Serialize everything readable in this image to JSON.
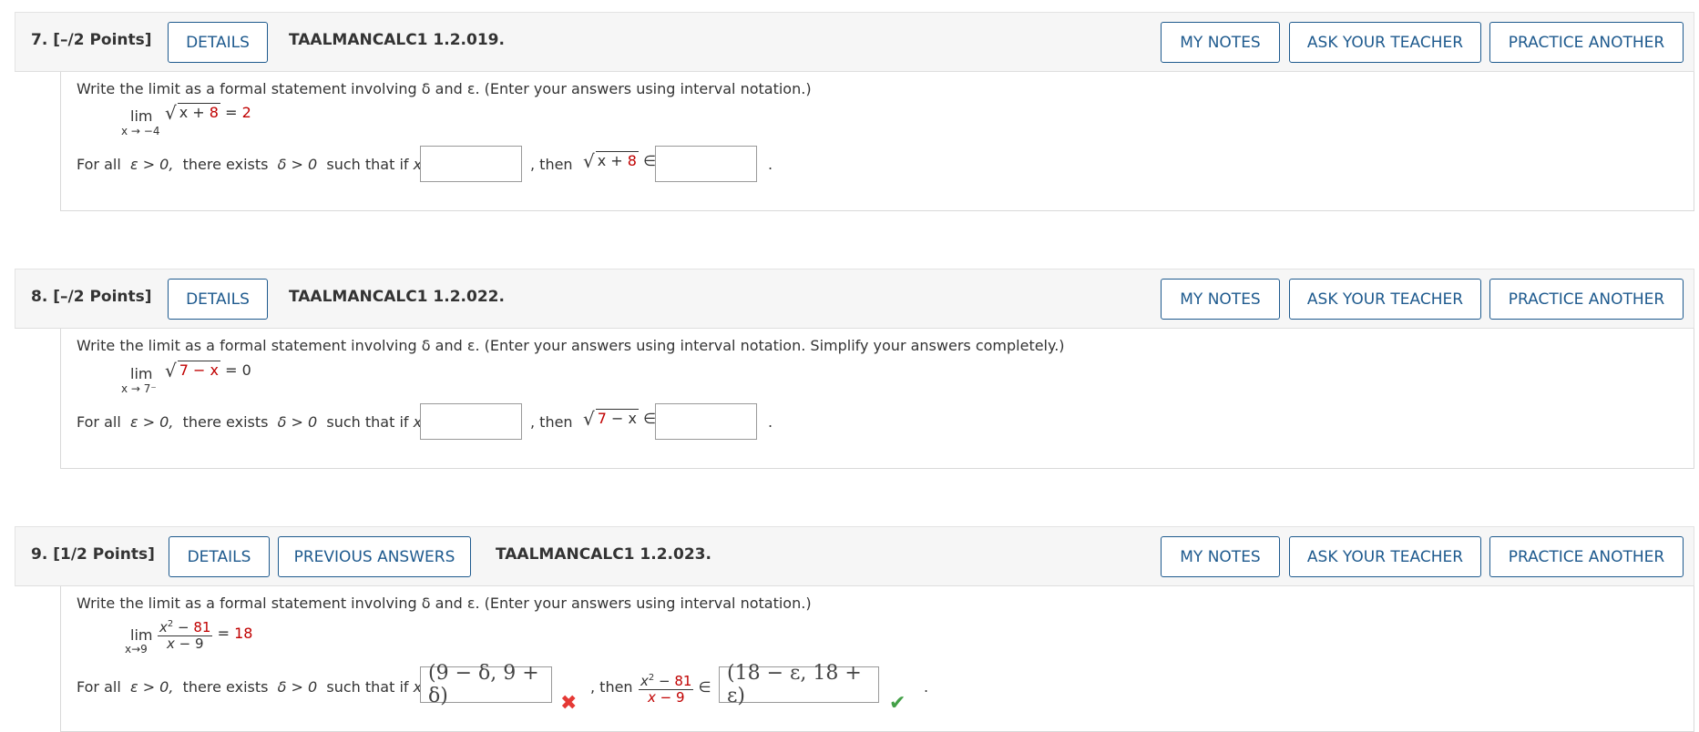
{
  "questions": [
    {
      "number": "7.",
      "points": "[–/2 Points]",
      "code": "TAALMANCALC1 1.2.019.",
      "prompt": "Write the limit as a formal statement involving δ and ε. (Enter your answers using interval notation.)",
      "limit_sub": "x → −4",
      "limit_expr": "x + 8",
      "limit_value": "2"
    },
    {
      "number": "8.",
      "points": "[–/2 Points]",
      "code": "TAALMANCALC1 1.2.022.",
      "prompt": "Write the limit as a formal statement involving δ and ε. (Enter your answers using interval notation. Simplify your answers completely.)",
      "limit_sub": "x → 7⁻",
      "limit_expr": "7 − x",
      "limit_value": "0"
    },
    {
      "number": "9.",
      "points": "[1/2 Points]",
      "code": "TAALMANCALC1 1.2.023.",
      "prompt": "Write the limit as a formal statement involving δ and ε. (Enter your answers using interval notation.)",
      "limit_sub": "x→9",
      "limit_num": "x² − 81",
      "limit_den": "x − 9",
      "limit_value": "18",
      "answer1": "(9 − δ, 9 + δ)",
      "answer2": "(18 − ε, 18 + ε)"
    }
  ],
  "labels": {
    "details": "DETAILS",
    "previous_answers": "PREVIOUS ANSWERS",
    "my_notes": "MY NOTES",
    "ask_teacher": "ASK YOUR TEACHER",
    "practice_another": "PRACTICE ANOTHER",
    "lim": "lim",
    "equals": "=",
    "for_all": "For all",
    "eps_gt": "ε > 0,",
    "there_exists": "there exists",
    "delta_gt": "δ > 0",
    "such_that": "such that if",
    "x_in": "x ∈",
    "then": ", then",
    "in": "∈",
    "period": "."
  },
  "colors": {
    "accent": "#1e5a8e",
    "highlight": "#c00000",
    "incorrect": "#e53935",
    "correct": "#43a047"
  },
  "icons": {
    "incorrect": "cross-mark-icon",
    "correct": "check-mark-icon"
  }
}
